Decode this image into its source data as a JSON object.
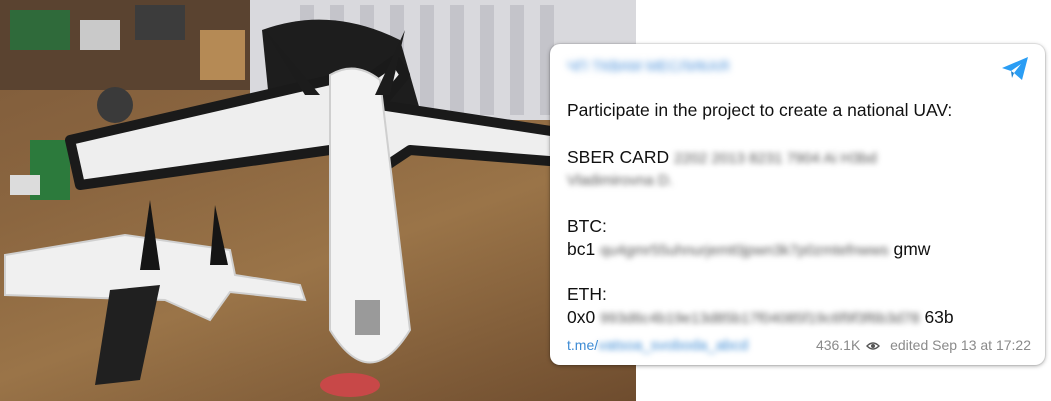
{
  "telegram_post": {
    "channel_name": "ЧП ТКВАМ МЕСЛИКАЯ",
    "send_icon": "telegram-plane-icon",
    "intro": "Participate in the project to create a national UAV:",
    "sber_label": "SBER CARD",
    "sber_number_hidden": "2202 2013 8231 7904 Ai H3bd",
    "sber_owner_hidden": "Vladimirovna D.",
    "btc_label": "BTC:",
    "btc_prefix": "bc1",
    "btc_hidden": "qu4gmr55uhnurjemt0jpwn3k7p0zmtefnwws",
    "btc_suffix": "gmw",
    "eth_label": "ETH:",
    "eth_prefix": "0x0",
    "eth_hidden": "993d6c4b19e13d85b17f04085f19c6f9f3f6b3d78",
    "eth_suffix": "63b",
    "link_prefix": "t.me/",
    "link_hidden": "vatsoa_svoboda_abcd",
    "views": "436.1K",
    "views_icon": "eye-icon",
    "edited": "edited Sep 13 at 17:22"
  }
}
